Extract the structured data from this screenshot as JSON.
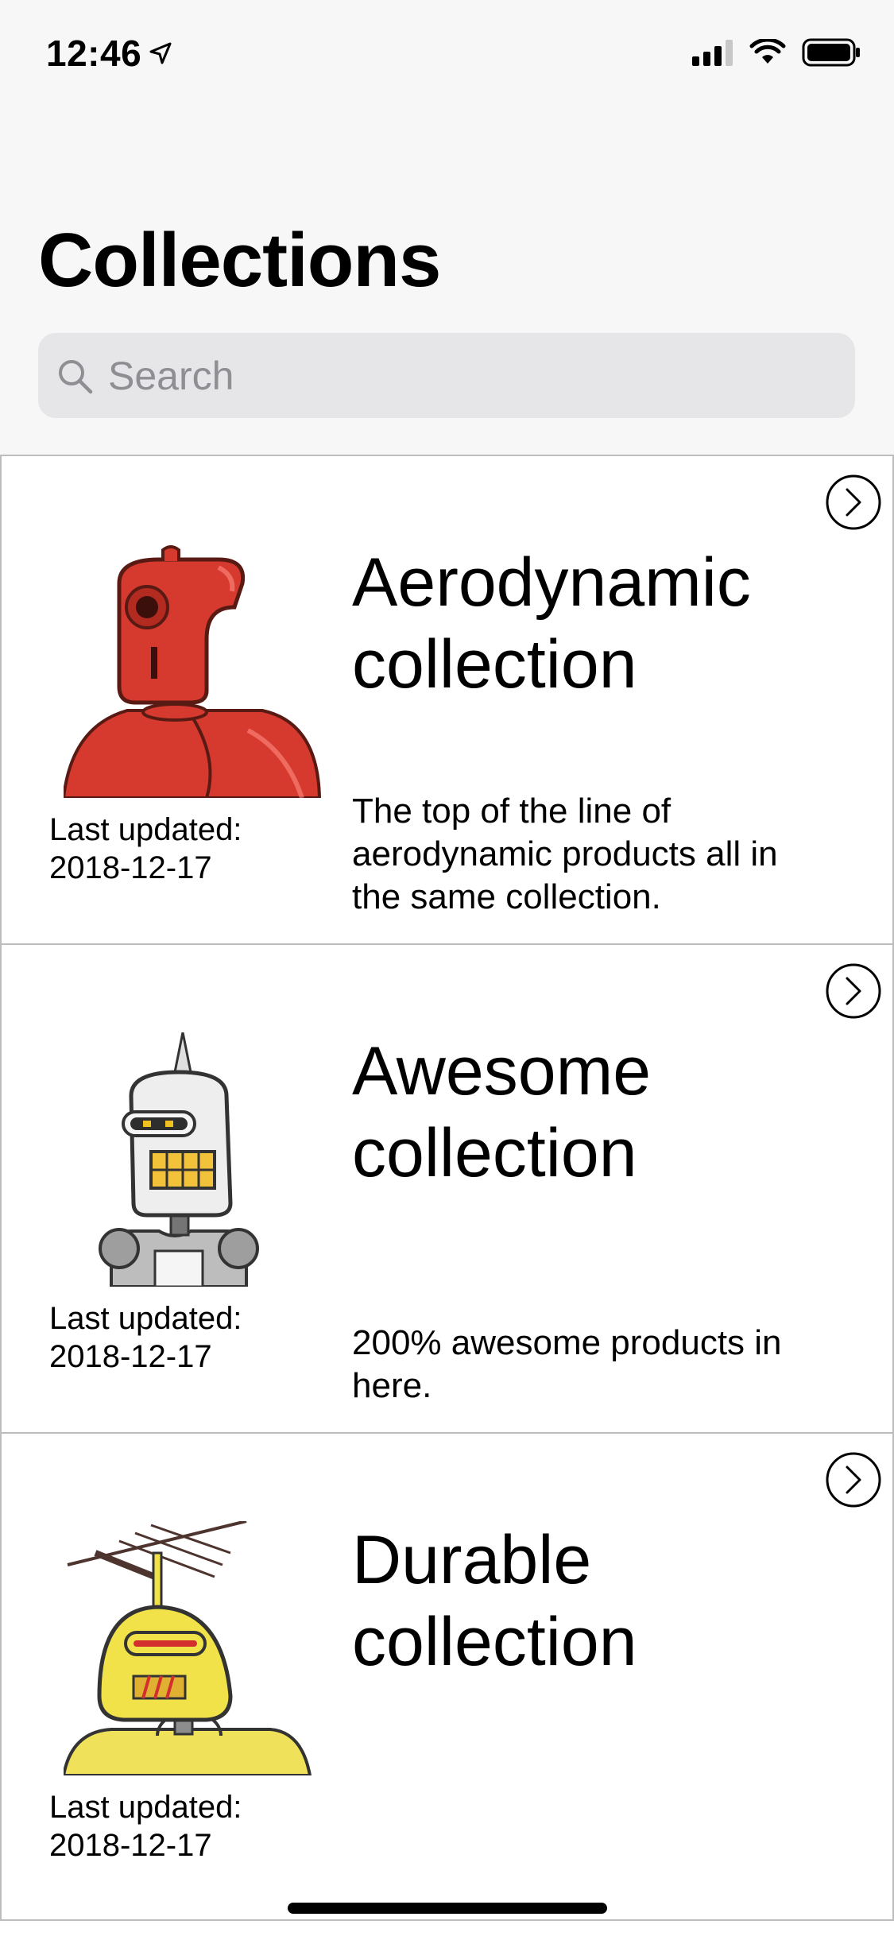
{
  "status_bar": {
    "time": "12:46",
    "icons": [
      "location-arrow-icon",
      "cellular-signal-icon",
      "wifi-icon",
      "battery-icon"
    ]
  },
  "header": {
    "title": "Collections"
  },
  "search": {
    "placeholder": "Search"
  },
  "collections": [
    {
      "name": "Aerodynamic collection",
      "updated_label": "Last updated:",
      "updated_date": "2018-12-17",
      "description": "The top of the line of aerodynamic products all in the same collection.",
      "image": "red-robot-illustration"
    },
    {
      "name": "Awesome collection",
      "updated_label": "Last updated:",
      "updated_date": "2018-12-17",
      "description": "200% awesome products in here.",
      "image": "white-robot-illustration"
    },
    {
      "name": "Durable collection",
      "updated_label": "Last updated:",
      "updated_date": "2018-12-17",
      "description": "",
      "image": "yellow-robot-illustration"
    }
  ]
}
